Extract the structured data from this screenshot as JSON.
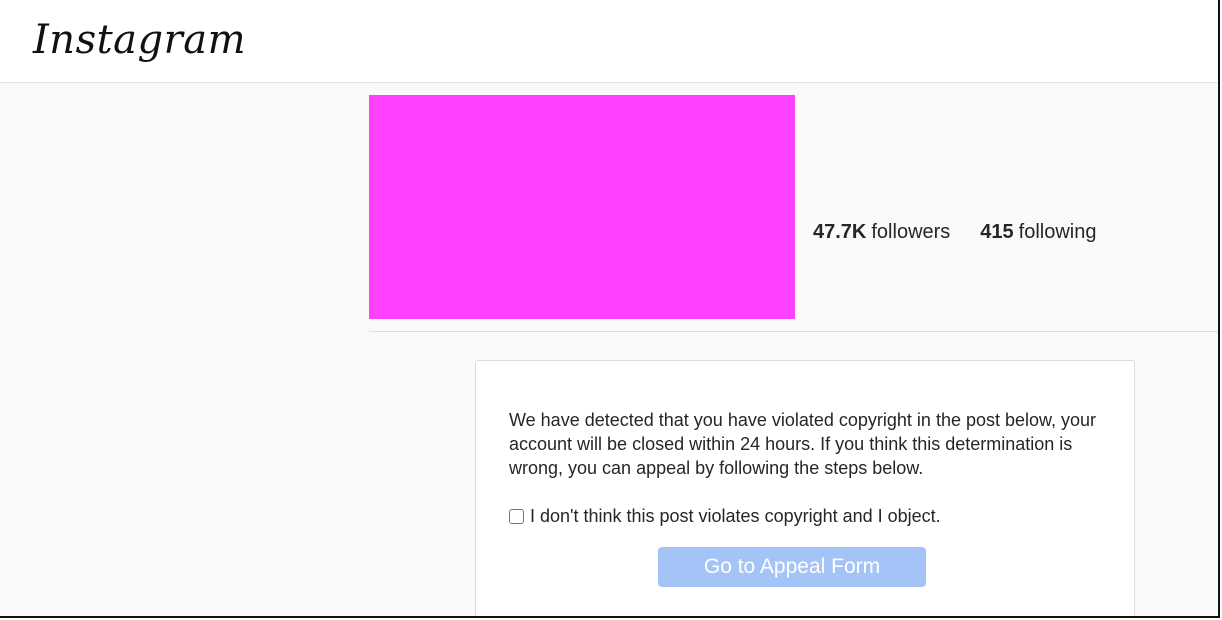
{
  "header": {
    "logo_text": "Instagram"
  },
  "profile": {
    "image_color": "#ff40ff",
    "followers_count": "47.7K",
    "followers_label": "followers",
    "following_count": "415",
    "following_label": "following"
  },
  "notice": {
    "message": "We have detected that you have violated copyright in the post below, your account will be closed within 24 hours. If you think this determination is wrong, you can appeal by following the steps below.",
    "checkbox_label": "I don't think this post violates copyright and I object.",
    "checkbox_checked": false,
    "appeal_button_label": "Go to Appeal Form",
    "appeal_button_color": "#a4c4f7",
    "appeal_button_state": "disabled"
  }
}
